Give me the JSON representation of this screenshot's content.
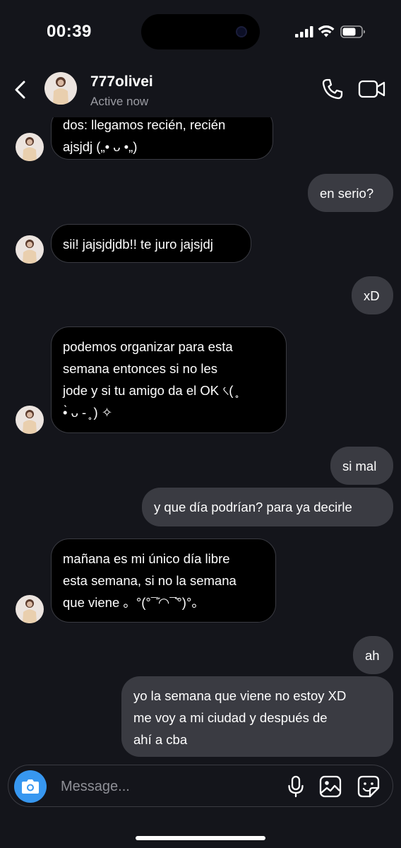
{
  "status_bar": {
    "time": "00:39",
    "icons": [
      "cellular-signal-icon",
      "wifi-icon",
      "battery-icon"
    ]
  },
  "header": {
    "contact_name": "777olivei",
    "contact_status": "Active now",
    "icons": [
      "back-icon",
      "avatar",
      "phone-icon",
      "video-camera-icon"
    ]
  },
  "messages": [
    {
      "from": "them",
      "text": "dos: llegamos recién, recién\najsjdj („• ᴗ •„)"
    },
    {
      "from": "me",
      "text": "en serio?"
    },
    {
      "from": "them",
      "text": "sii! jajsjdjdb!! te juro jajsjdj"
    },
    {
      "from": "me",
      "text": "xD"
    },
    {
      "from": "them",
      "text": "podemos organizar para esta\nsemana entonces si no les\njode y si tu amigo da el OK ৻(  ̥\n•̀ ᴗ - ̥ ) ✧"
    },
    {
      "from": "me",
      "text": "si mal"
    },
    {
      "from": "me",
      "text": "y que día podrían? para ya decirle"
    },
    {
      "from": "them",
      "text": "mañana es mi único día libre\nesta semana, si no la semana\nque viene 。°(°¯᷄◠¯᷅°)°。"
    },
    {
      "from": "me",
      "text": "ah"
    },
    {
      "from": "me",
      "text": "yo la semana que viene no estoy XD\nme voy a mi ciudad y después de\nahí a cba"
    }
  ],
  "composer": {
    "placeholder": "Message...",
    "accent_color": "#3797f0",
    "icons": [
      "camera-icon",
      "microphone-icon",
      "gallery-icon",
      "sticker-icon"
    ]
  },
  "colors": {
    "background": "#14151b",
    "incoming_bubble": "#000000",
    "incoming_border": "#3a3b42",
    "outgoing_bubble": "#3a3b42",
    "secondary_text": "#9b9ca3"
  }
}
